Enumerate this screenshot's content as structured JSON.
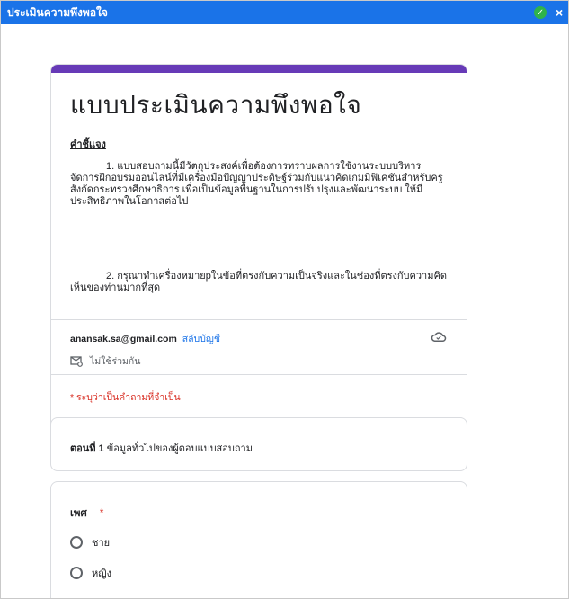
{
  "window": {
    "title": "ประเมินความพึงพอใจ",
    "close_glyph": "×",
    "check_glyph": "✓"
  },
  "form": {
    "title": "แบบประเมินความพึงพอใจ",
    "instructions_title": "คำชี้แจง",
    "paragraph1": "1. แบบสอบถามนี้มีวัตถุประสงค์เพื่อต้องการทราบผลการใช้งานระบบบริหารจัดการฝึกอบรมออนไลน์ที่มีเครื่องมือปัญญาประดิษฐ์ร่วมกับแนวคิดเกมมิฟิเคชันสำหรับครูสังกัดกระทรวงศึกษาธิการ เพื่อเป็นข้อมูลพื้นฐานในการปรับปรุงและพัฒนาระบบ  ให้มีประสิทธิภาพในโอกาสต่อไป",
    "paragraph2": "2. กรุณาทำเครื่องหมายpในข้อที่ตรงกับความเป็นจริงและในช่องที่ตรงกับความคิดเห็นของท่านมากที่สุด",
    "email": "anansak.sa@gmail.com",
    "switch_account": "สลับบัญชี",
    "not_shared": "ไม่ใช้ร่วมกัน",
    "required_note": "* ระบุว่าเป็นคำถามที่จำเป็น"
  },
  "section": {
    "label": "ตอนที่ 1",
    "text": " ข้อมูลทั่วไปของผู้ตอบแบบสอบถาม"
  },
  "question": {
    "title": "เพศ",
    "required_mark": "*",
    "options": [
      "ชาย",
      "หญิง"
    ]
  }
}
